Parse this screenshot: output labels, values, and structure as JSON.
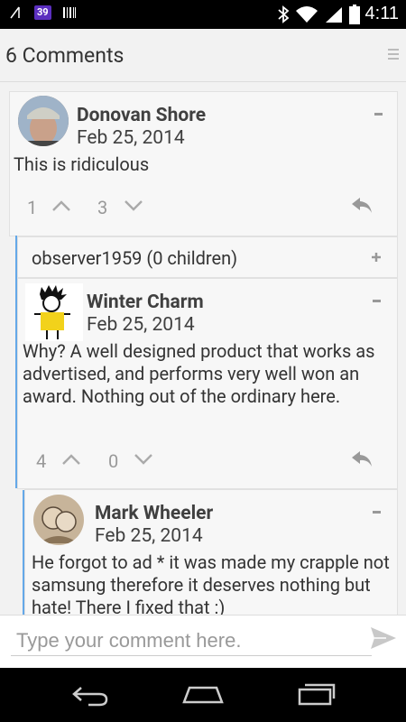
{
  "status_bar": {
    "badge": "39",
    "time": "4:11"
  },
  "header": {
    "title": "6 Comments"
  },
  "comments": [
    {
      "author": "Donovan Shore",
      "date": "Feb 25, 2014",
      "body": "This is ridiculous",
      "up": "1",
      "down": "3"
    },
    {
      "author": "Winter Charm",
      "date": "Feb 25, 2014",
      "body": "Why? A well designed product that works as advertised, and performs very well won an award. Nothing out of the ordinary here.",
      "up": "4",
      "down": "0"
    },
    {
      "author": "Mark Wheeler",
      "date": "Feb 25, 2014",
      "body": "He forgot to ad * it was made my crapple not samsung therefore it deserves nothing but hate! There I fixed that :)"
    }
  ],
  "collapsed_thread": {
    "label": "observer1959 (0 children)"
  },
  "composer": {
    "placeholder": "Type your comment here."
  }
}
